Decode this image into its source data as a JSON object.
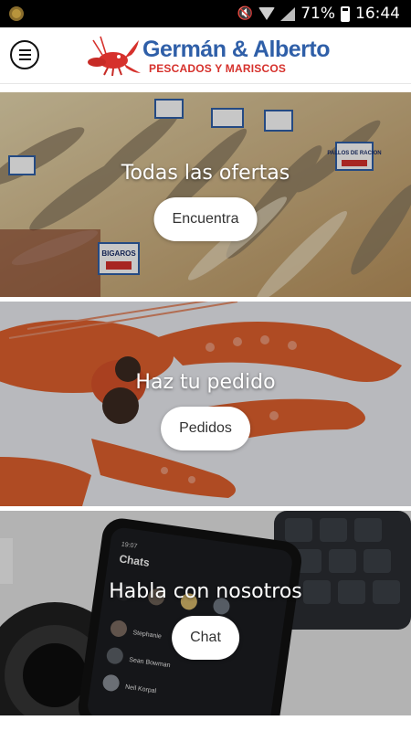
{
  "status_bar": {
    "battery_percent": "71%",
    "time": "16:44",
    "icons": [
      "app-coin-icon",
      "mute-icon",
      "wifi-icon",
      "signal-icon",
      "battery-icon"
    ]
  },
  "header": {
    "menu_icon": "hamburger-menu-icon",
    "logo_icon": "lobster-logo-icon",
    "brand_name": "Germán & Alberto",
    "brand_subtitle": "PESCADOS Y MARISCOS",
    "brand_color": "#2f5fa8",
    "subtitle_color": "#d6312c"
  },
  "cards": [
    {
      "image": "fish-market-counter-image",
      "title": "Todas las ofertas",
      "button": "Encuentra",
      "image_price_tags": [
        "BIGAROS",
        "PALLOS DE RACION"
      ]
    },
    {
      "image": "langoustine-image",
      "title": "Haz tu pedido",
      "button": "Pedidos"
    },
    {
      "image": "phone-chat-app-image",
      "title": "Habla con nosotros",
      "button": "Chat",
      "image_phone_texts": {
        "time": "19:07",
        "header": "Chats",
        "contacts": [
          "Sean Bowman",
          "Stephanie",
          "Neil Korpal"
        ]
      }
    }
  ]
}
